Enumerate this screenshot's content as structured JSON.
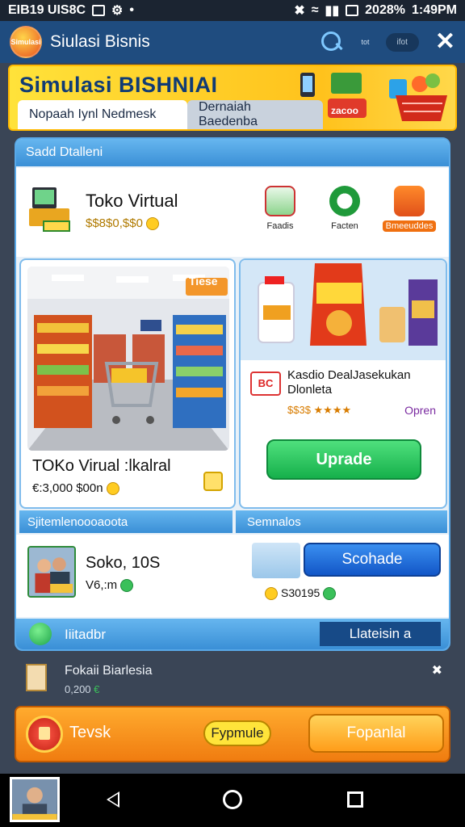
{
  "status": {
    "left_text": "EIB19 UIS8C",
    "battery": "2028%",
    "time": "1:49PM"
  },
  "appbar": {
    "logo_text": "Simulasi",
    "title": "Siulasi Bisnis",
    "small_text": "tot",
    "pill_text": "ifot"
  },
  "banner": {
    "title": "Simulasi BISHNIAI",
    "tab_active": "Nopaah Iynl Nedmesk",
    "tab_inactive": "Dernaiah Baedenba",
    "price_tag": "zacoo"
  },
  "shop": {
    "section_title": "Sadd Dtalleni",
    "store_name": "Toko Virtual",
    "store_money": "$$8$0,$$0",
    "mini_items": [
      {
        "label": "Faadis"
      },
      {
        "label": "Facten"
      },
      {
        "label": "Bmeeuddes"
      }
    ]
  },
  "left_panel": {
    "store_tag": "Tiese",
    "title": "TOKo Virual :lkalral",
    "money": "€:3,000 $00n"
  },
  "right_panel": {
    "icon_text": "BC",
    "title": "Kasdio DealJasekukan Dlonleta",
    "rating": "$$3$ ★★★★",
    "open_text": "Opren",
    "upgrade_label": "Uprade"
  },
  "employees": {
    "left_header": "Sjitemlenoooaoota",
    "right_header": "Semnalos",
    "emp_name": "Soko, 10S",
    "emp_value": "V6,:m",
    "schedule_label": "Scohade",
    "schedule_value": "S30195"
  },
  "footer_bar": {
    "label": "Iiitadbr",
    "button": "Llateisin a"
  },
  "notice": {
    "title": "Fokaii Biarlesia",
    "value": "0,200"
  },
  "actions": {
    "left_label": "Tevsk",
    "pill": "Fypmule",
    "button": "Fopanlal"
  }
}
